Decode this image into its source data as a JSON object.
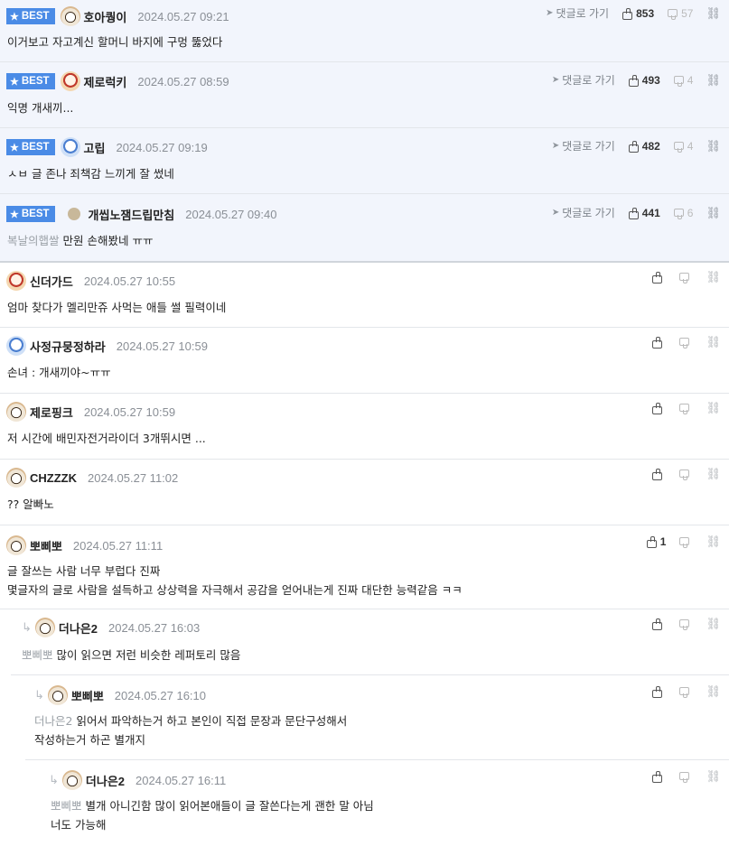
{
  "goto_label": "댓글로 가기",
  "best_label": "BEST",
  "best": [
    {
      "nick": "호아퀑이",
      "date": "2024.05.27 09:21",
      "text": "이거보고 자고계신 할머니 바지에 구멍 뚫었다",
      "up": "853",
      "down": "57",
      "ref": ""
    },
    {
      "nick": "제로럭키",
      "date": "2024.05.27 08:59",
      "text": "익명 개새끼...",
      "up": "493",
      "down": "4",
      "ref": ""
    },
    {
      "nick": "고립",
      "date": "2024.05.27 09:19",
      "text": "ㅅㅂ 글 존나 죄책감 느끼게 잘 썼네",
      "up": "482",
      "down": "4",
      "ref": ""
    },
    {
      "nick": "개씹노잼드립만침",
      "date": "2024.05.27 09:40",
      "text": "만원 손해봤네 ㅠㅠ",
      "up": "441",
      "down": "6",
      "ref": "복날의햅쌀"
    }
  ],
  "comments": [
    {
      "nick": "신더가드",
      "date": "2024.05.27 10:55",
      "lines": [
        "엄마 찾다가 멜리만쥬 사먹는 애들 썰 필력이네"
      ],
      "up": "",
      "ref": ""
    },
    {
      "nick": "사정규뭉정하라",
      "date": "2024.05.27 10:59",
      "lines": [
        "손녀 : 개새끼야~ㅠㅠ"
      ],
      "up": "",
      "ref": ""
    },
    {
      "nick": "제로핑크",
      "date": "2024.05.27 10:59",
      "lines": [
        "저 시간에 배민자전거라이더 3개뛰시면 ..."
      ],
      "up": "",
      "ref": ""
    },
    {
      "nick": "CHZZZK",
      "date": "2024.05.27 11:02",
      "lines": [
        "?? 알빠노"
      ],
      "up": "",
      "ref": ""
    },
    {
      "nick": "뽀삐뽀",
      "date": "2024.05.27 11:11",
      "lines": [
        "글 잘쓰는 사람 너무 부럽다 진짜",
        "몇글자의 글로 사람을 설득하고 상상력을 자극해서 공감을 얻어내는게 진짜 대단한 능력같음 ㅋㅋ"
      ],
      "up": "1",
      "ref": ""
    },
    {
      "nick": "더나은2",
      "date": "2024.05.27 16:03",
      "lines": [
        "많이 읽으면 저런 비슷한 레퍼토리 많음"
      ],
      "up": "",
      "ref": "뽀삐뽀"
    },
    {
      "nick": "뽀삐뽀",
      "date": "2024.05.27 16:10",
      "lines": [
        "읽어서 파악하는거 하고 본인이 직접 문장과 문단구성해서",
        "작성하는거 하곤 별개지"
      ],
      "up": "",
      "ref": "더나은2"
    },
    {
      "nick": "더나은2",
      "date": "2024.05.27 16:11",
      "lines": [
        "별개 아니긴함 많이 읽어본애들이 글 잘쓴다는게 괜한 말 아님",
        "너도 가능해"
      ],
      "up": "",
      "ref": "뽀삐뽀"
    }
  ]
}
